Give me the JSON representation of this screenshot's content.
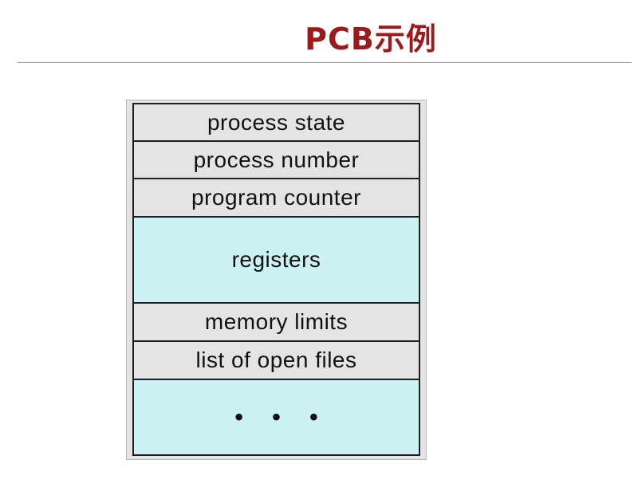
{
  "slide": {
    "title": "PCB示例",
    "title_color": "#9b1b1b",
    "rule_color": "#9a9a9a"
  },
  "pcb_block": {
    "fields": [
      {
        "label": "process state",
        "fill": "gray"
      },
      {
        "label": "process number",
        "fill": "gray"
      },
      {
        "label": "program counter",
        "fill": "gray"
      },
      {
        "label": "registers",
        "fill": "cyan"
      },
      {
        "label": "memory limits",
        "fill": "gray"
      },
      {
        "label": "list of open files",
        "fill": "gray"
      },
      {
        "label": "• • •",
        "fill": "cyan"
      }
    ],
    "colors": {
      "gray": "#e4e4e4",
      "cyan": "#ccf2f4",
      "border": "#202020"
    }
  }
}
